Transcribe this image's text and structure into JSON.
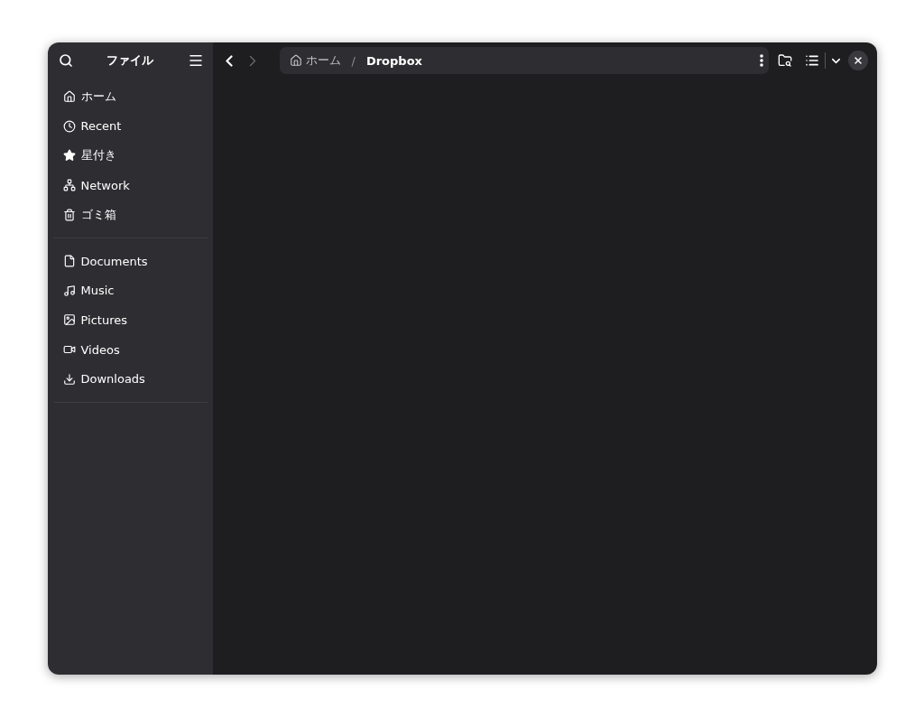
{
  "sidebar": {
    "title": "ファイル",
    "places": [
      {
        "label": "ホーム"
      },
      {
        "label": "Recent"
      },
      {
        "label": "星付き"
      },
      {
        "label": "Network"
      },
      {
        "label": "ゴミ箱"
      }
    ],
    "bookmarks": [
      {
        "label": "Documents"
      },
      {
        "label": "Music"
      },
      {
        "label": "Pictures"
      },
      {
        "label": "Videos"
      },
      {
        "label": "Downloads"
      }
    ]
  },
  "navigation": [
    {
      "disabled": false
    },
    {
      "disabled": true
    }
  ],
  "path": {
    "separator": "/",
    "crumbs": [
      {
        "label": "ホーム",
        "current": false
      },
      {
        "label": "Dropbox",
        "current": true
      }
    ]
  }
}
